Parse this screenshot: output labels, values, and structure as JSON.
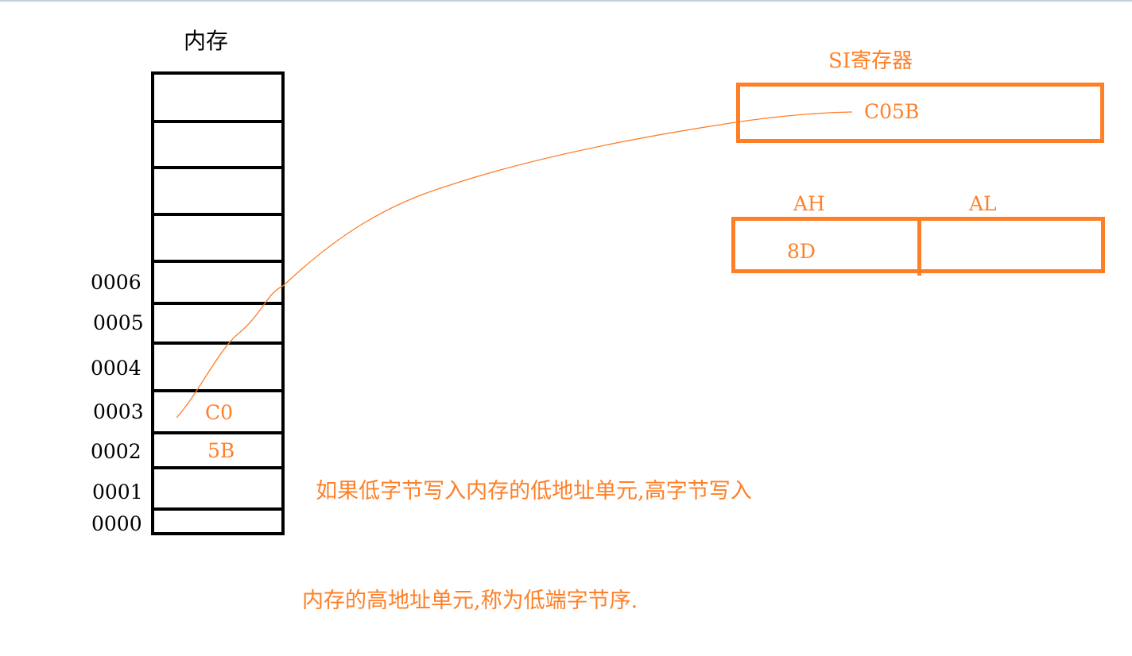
{
  "memory": {
    "title": "内存",
    "addresses": [
      {
        "label": "0006"
      },
      {
        "label": "0005"
      },
      {
        "label": "0004"
      },
      {
        "label": "0003",
        "value": "C0"
      },
      {
        "label": "0002",
        "value": "5B"
      },
      {
        "label": "0001"
      },
      {
        "label": "0000"
      }
    ],
    "empty_cells_above": 4
  },
  "si_register": {
    "title": "SI寄存器",
    "value": "C05B"
  },
  "ax_register": {
    "high_label": "AH",
    "low_label": "AL",
    "high_value": "8D",
    "low_value": ""
  },
  "description": {
    "line1": "  如果低字节写入内存的低地址单元,高字节写入",
    "line2": "内存的高地址单元,称为低端字节序."
  },
  "colors": {
    "accent": "#ff7f27",
    "memory_border": "#000000",
    "top_bar": "#c6cfe0"
  }
}
